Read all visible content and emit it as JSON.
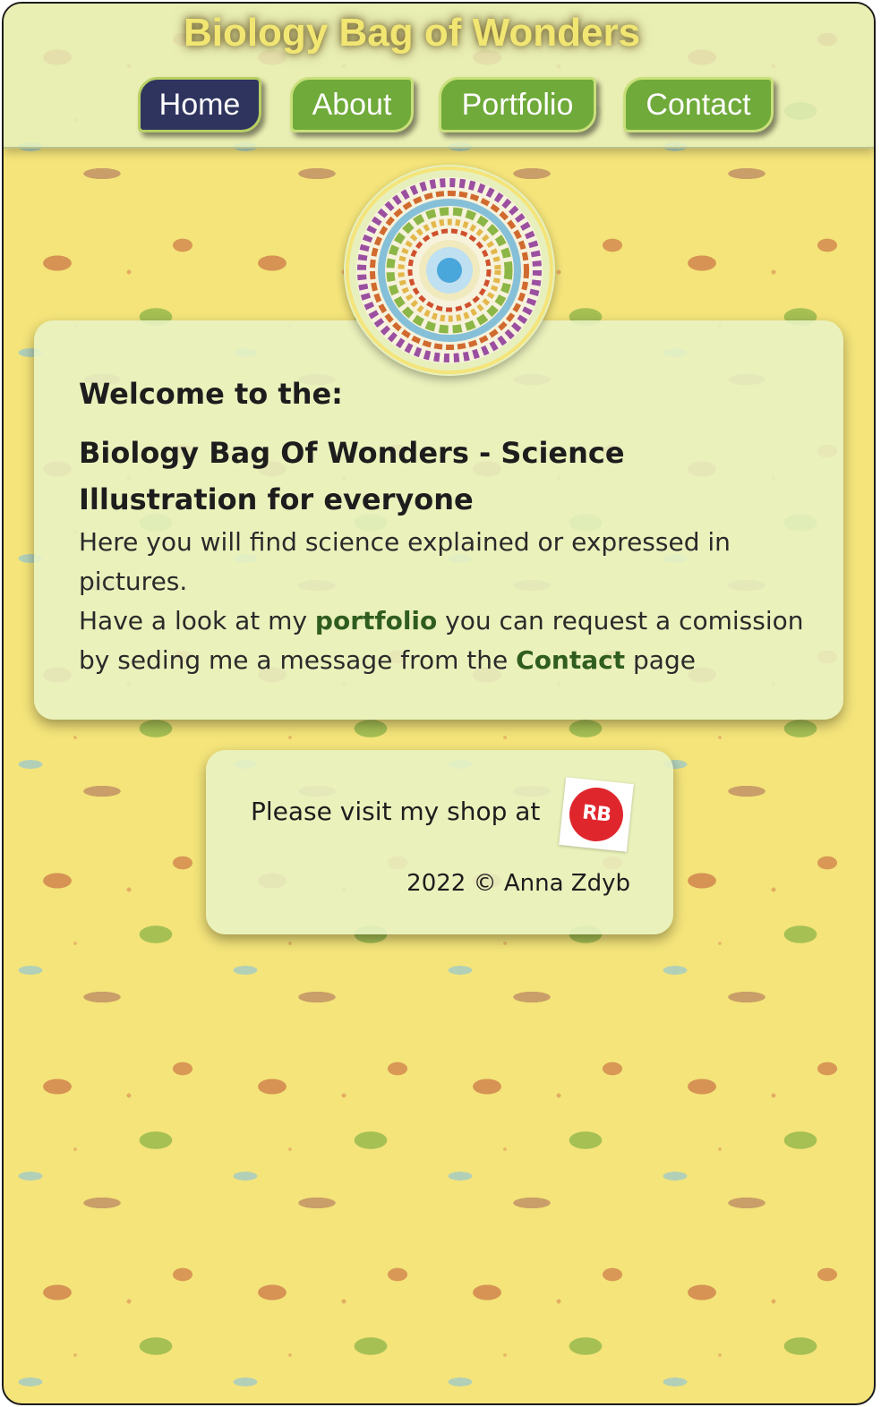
{
  "header": {
    "title": "Biology Bag of Wonders",
    "nav": [
      {
        "label": "Home",
        "active": true
      },
      {
        "label": "About",
        "active": false
      },
      {
        "label": "Portfolio",
        "active": false
      },
      {
        "label": "Contact",
        "active": false
      }
    ]
  },
  "main": {
    "welcome": "Welcome to the:",
    "subtitle": "Biology Bag Of Wonders - Science Illustration for everyone",
    "paragraph1": "Here you will find science explained or expressed in pictures.",
    "p2_before": "Have a look at my ",
    "p2_link1": "portfolio",
    "p2_middle": " you can request a comission by seding me a message from the ",
    "p2_link2": "Contact",
    "p2_after": " page"
  },
  "footer": {
    "shop_text": "Please visit my shop at",
    "shop_badge": "RB",
    "copyright": "2022 © Anna Zdyb"
  },
  "colors": {
    "accent_green": "#6faa3a",
    "active_nav": "#2f345e",
    "title_yellow": "#f1e672",
    "background_yellow": "#f4e47a",
    "link_green": "#2f5d1f",
    "badge_red": "#e0262d"
  }
}
